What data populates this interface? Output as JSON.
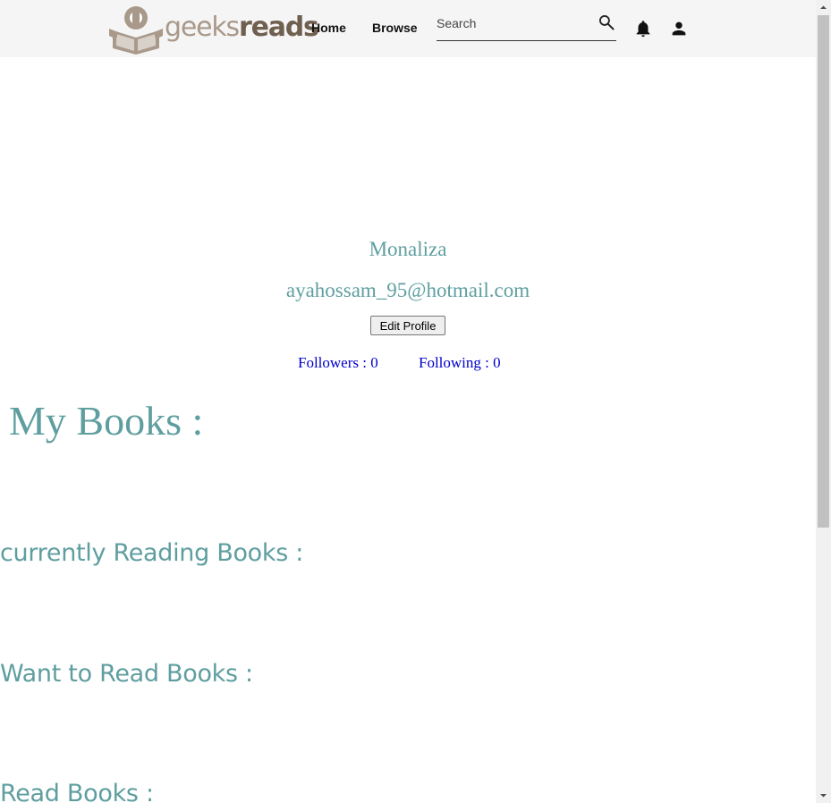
{
  "navbar": {
    "logo_text_light": "geeks",
    "logo_text_bold": "reads",
    "home_label": "Home",
    "browse_label": "Browse",
    "search_placeholder": "Search",
    "icons": {
      "search": "search-icon",
      "notifications": "bell-icon",
      "account": "person-icon"
    }
  },
  "profile": {
    "name": "Monaliza",
    "email": "ayahossam_95@hotmail.com",
    "edit_label": "Edit Profile",
    "followers_label": "Followers : 0",
    "following_label": "Following : 0"
  },
  "books": {
    "heading": "My Books :",
    "currently_reading": "currently Reading Books :",
    "want_to_read": "Want to Read Books :",
    "read": "Read Books :"
  },
  "colors": {
    "accent": "#5f9ea0",
    "link": "#0000cc",
    "navbar_bg": "#f5f5f5",
    "logo_light": "#a9998a",
    "logo_dark": "#6f5f4f"
  }
}
